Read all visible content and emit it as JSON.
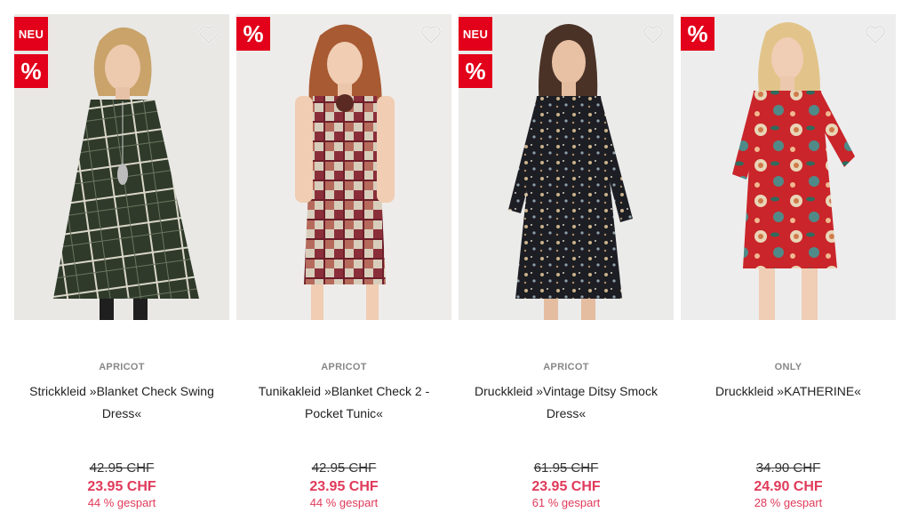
{
  "colors": {
    "badge_red": "#e2001a",
    "sale_price": "#e03a5a"
  },
  "products": [
    {
      "badges": [
        "NEU",
        "%"
      ],
      "brand": "APRICOT",
      "title": "Strickkleid »Blanket Check Swing Dress«",
      "old_price": "42.95 CHF",
      "new_price": "23.95 CHF",
      "saved": "44 % gespart",
      "wishlist_icon": "heart-outline-icon"
    },
    {
      "badges": [
        "%"
      ],
      "brand": "APRICOT",
      "title": "Tunikakleid »Blanket Check 2 - Pocket Tunic«",
      "old_price": "42.95 CHF",
      "new_price": "23.95 CHF",
      "saved": "44 % gespart",
      "wishlist_icon": "heart-outline-icon"
    },
    {
      "badges": [
        "NEU",
        "%"
      ],
      "brand": "APRICOT",
      "title": "Druckkleid »Vintage Ditsy Smock Dress«",
      "old_price": "61.95 CHF",
      "new_price": "23.95 CHF",
      "saved": "61 % gespart",
      "wishlist_icon": "heart-outline-icon"
    },
    {
      "badges": [
        "%"
      ],
      "brand": "ONLY",
      "title": "Druckkleid »KATHERINE«",
      "old_price": "34.90 CHF",
      "new_price": "24.90 CHF",
      "saved": "28 % gespart",
      "wishlist_icon": "heart-outline-icon"
    }
  ]
}
